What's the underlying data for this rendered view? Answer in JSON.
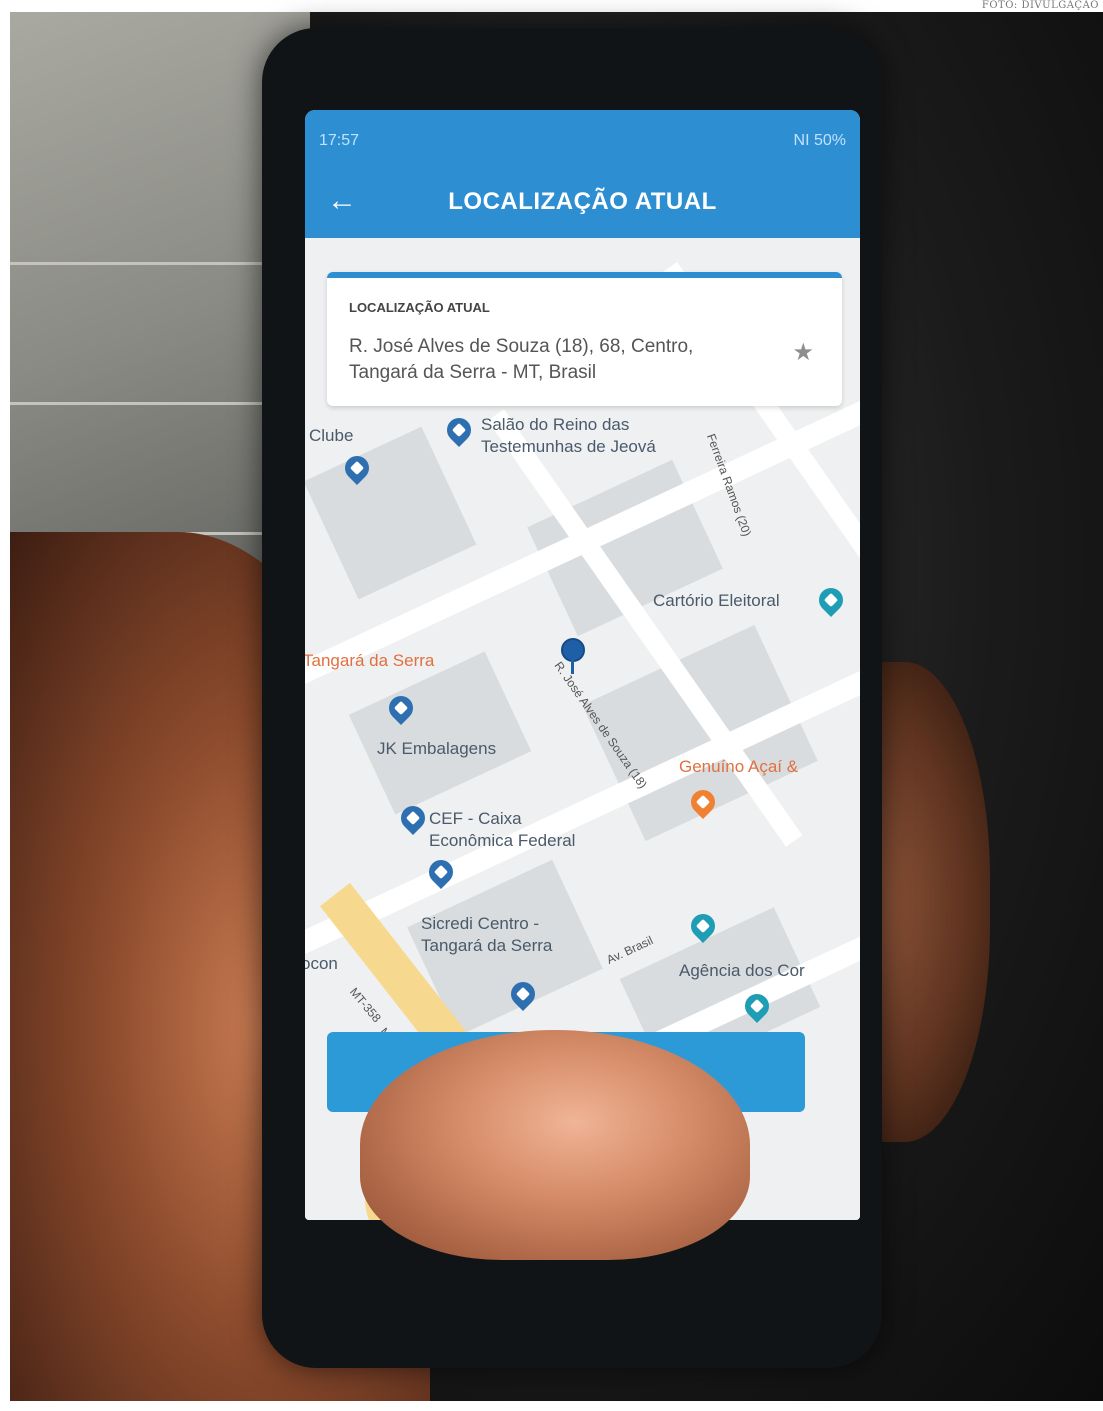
{
  "credit": "FOTO: DIVULGAÇÃO",
  "status_bar": {
    "time": "17:57",
    "right_text": "NI 50%"
  },
  "app_bar": {
    "title": "LOCALIZAÇÃO ATUAL",
    "back_icon": "arrow-left-icon"
  },
  "card": {
    "label": "LOCALIZAÇÃO ATUAL",
    "address_line1": "R. José Alves de Souza (18), 68, Centro,",
    "address_line2": "Tangará da Serra - MT, Brasil",
    "favorite_icon": "star-icon"
  },
  "map": {
    "pois": [
      {
        "name": "Clube"
      },
      {
        "name": "Salão do Reino das"
      },
      {
        "name": "Testemunhas de Jeová"
      },
      {
        "name": "Cartório Eleitoral"
      },
      {
        "name": "Tangará da Serra"
      },
      {
        "name": "JK Embalagens"
      },
      {
        "name": "Genuíno Açaí &"
      },
      {
        "name": "CEF - Caixa"
      },
      {
        "name": "Econômica Federal"
      },
      {
        "name": "Sicredi Centro -"
      },
      {
        "name": "Tangará da Serra"
      },
      {
        "name": "Agência dos Cor"
      },
      {
        "name": "ocon"
      }
    ],
    "streets": [
      {
        "name": "R. José Alves de Souza (18)"
      },
      {
        "name": "Ferreira Ramos (20)"
      },
      {
        "name": "MT-358"
      },
      {
        "name": "MT-358"
      },
      {
        "name": "Av. Brasil"
      }
    ]
  }
}
